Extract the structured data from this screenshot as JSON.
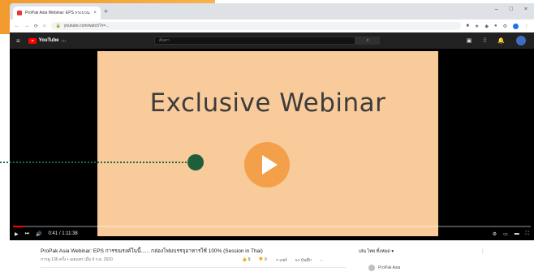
{
  "browser": {
    "tab_title": "ProPak Asia Webinar: EPS กระบวน...",
    "tab_close": "×",
    "new_tab": "+",
    "window_controls": [
      "–",
      "□",
      "×"
    ],
    "address": "youtube.com/watch?v=...",
    "nav": [
      "←",
      "→",
      "⟳",
      "⌂"
    ]
  },
  "youtube": {
    "logo_text": "YouTube",
    "logo_suffix": "TH",
    "search_placeholder": "ค้นหา",
    "search_icon": "search-icon"
  },
  "video": {
    "poster_title": "Exclusive Webinar",
    "progress_fraction": 0.02,
    "time": "0:41 / 1:11:38"
  },
  "info": {
    "title": "ProPak Asia Webinar: EPS การรณรงค์ในนี้...... กล่องโฟมบรรจุอาหารใช้ 100% (Session in Thai)",
    "meta": "การดู 136 ครั้ง • เผยแพร่ เมื่อ 9 ก.ย. 2020",
    "actions": [
      "👍 9",
      "👎 0",
      "↗ แชร์",
      "≡+ บันทึก",
      "..."
    ]
  },
  "sidebar": {
    "up_next": "เล่น ไทย ทั้งหมด ▾",
    "more": "⋮",
    "channel": "ProPak Asia"
  },
  "colors": {
    "accent_orange": "#f29a2e",
    "poster_bg": "#f9ca9a",
    "play_button": "#f4a04a",
    "connector_green": "#1f5e3b",
    "youtube_red": "#ff0000"
  }
}
